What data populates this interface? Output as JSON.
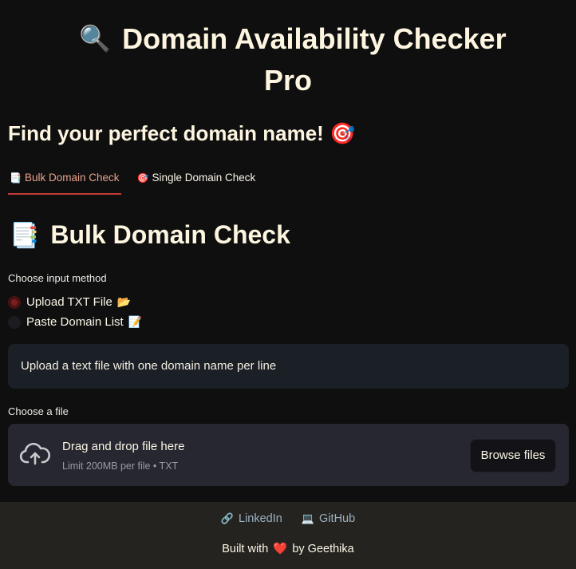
{
  "header": {
    "title_icon": "🔍",
    "title_line1": "Domain Availability Checker",
    "title_line2": "Pro",
    "subtitle": "Find your perfect domain name!",
    "subtitle_icon": "🎯"
  },
  "tabs": [
    {
      "icon": "📑",
      "label": "Bulk Domain Check",
      "active": true
    },
    {
      "icon": "🎯",
      "label": "Single Domain Check",
      "active": false
    }
  ],
  "section": {
    "icon": "📑",
    "title": "Bulk Domain Check"
  },
  "input_method": {
    "label": "Choose input method",
    "options": [
      {
        "label": "Upload TXT File",
        "icon": "📂",
        "selected": true
      },
      {
        "label": "Paste Domain List",
        "icon": "📝",
        "selected": false
      }
    ]
  },
  "info": {
    "text": "Upload a text file with one domain name per line"
  },
  "uploader": {
    "label": "Choose a file",
    "drop_text": "Drag and drop file here",
    "limit_text": "Limit 200MB per file • TXT",
    "button_label": "Browse files"
  },
  "footer": {
    "linkedin_icon": "🔗",
    "linkedin_label": "LinkedIn",
    "github_icon": "💻",
    "github_label": "GitHub",
    "built_prefix": "Built with",
    "heart": "❤️",
    "built_suffix": "by Geethika"
  },
  "colors": {
    "background": "#0f0f10",
    "accent": "#c43a3a",
    "info_bg": "#1b1f26",
    "dropzone_bg": "#262730",
    "footer_bg": "#25231f",
    "link": "#9ab1c2"
  }
}
